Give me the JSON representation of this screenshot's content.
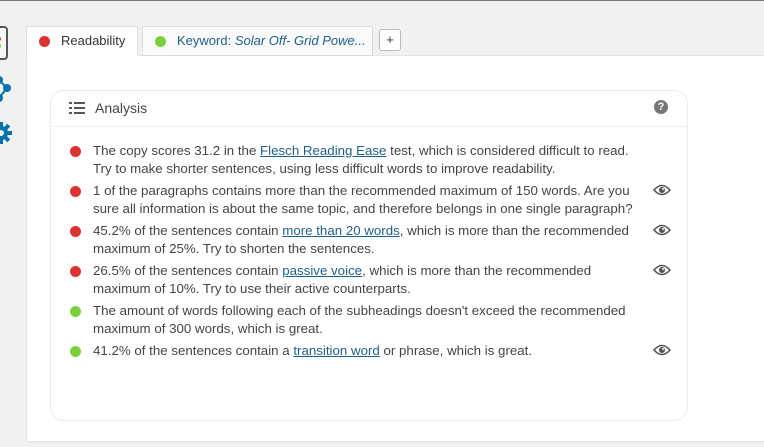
{
  "colors": {
    "bad": "#dc3232",
    "good": "#7ad03a",
    "link": "#1e5f8a"
  },
  "tabs": [
    {
      "label": "Readability",
      "status": "bad"
    },
    {
      "label": "Keyword: ",
      "value": "Solar Off- Grid Powe...",
      "status": "good"
    }
  ],
  "add_tab_label": "+",
  "analysis": {
    "title": "Analysis",
    "help_label": "?",
    "results": [
      {
        "status": "bad",
        "pre": "The copy scores 31.2 in the ",
        "link": "Flesch Reading Ease",
        "post": " test, which is considered difficult to read. Try to make shorter sentences, using less difficult words to improve readability.",
        "eye": false
      },
      {
        "status": "bad",
        "pre": "1 of the paragraphs contains more than the recommended maximum of 150 words. Are you sure all information is about the same topic, and therefore belongs in one single paragraph?",
        "link": "",
        "post": "",
        "eye": true
      },
      {
        "status": "bad",
        "pre": "45.2% of the sentences contain ",
        "link": "more than 20 words",
        "post": ", which is more than the recommended maximum of 25%. Try to shorten the sentences.",
        "eye": true
      },
      {
        "status": "bad",
        "pre": "26.5% of the sentences contain ",
        "link": "passive voice",
        "post": ", which is more than the recommended maximum of 10%. Try to use their active counterparts.",
        "eye": true
      },
      {
        "status": "good",
        "pre": "The amount of words following each of the subheadings doesn't exceed the recommended maximum of 300 words, which is great.",
        "link": "",
        "post": "",
        "eye": false
      },
      {
        "status": "good",
        "pre": "41.2% of the sentences contain a ",
        "link": "transition word",
        "post": " or phrase, which is great.",
        "eye": true
      }
    ]
  }
}
